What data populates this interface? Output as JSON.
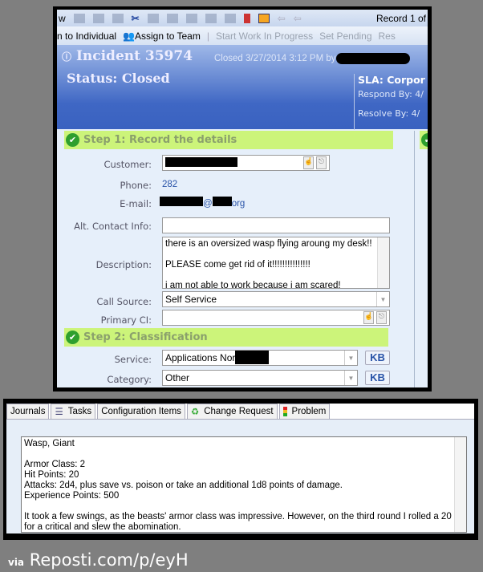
{
  "toolbar": {
    "view_fragment": "w",
    "record": "Record 1 of"
  },
  "actions": {
    "assign_individual": "n to Individual",
    "assign_team": "Assign to Team",
    "start_wip": "Start Work In Progress",
    "set_pending": "Set Pending",
    "resolve": "Res"
  },
  "header": {
    "incident": "Incident 35974",
    "closed": "Closed  3/27/2014 3:12 PM by",
    "status": "Status: Closed",
    "sla": "SLA: Corpor",
    "respond": "Respond By: 4/",
    "resolve": "Resolve By: 4/"
  },
  "step1": {
    "title": "Step 1:  Record the details",
    "customer_label": "Customer:",
    "phone_label": "Phone:",
    "phone": "282",
    "email_label": "E-mail:",
    "email_at": "@",
    "email_tld": "org",
    "alt_label": "Alt. Contact Info:",
    "alt_value": "",
    "desc_label": "Description:",
    "description": "there is an oversized wasp flying aroung my desk!!\n\nPLEASE come get rid of it!!!!!!!!!!!!!!!\n\ni am not able to work because i am scared!",
    "call_source_label": "Call Source:",
    "call_source": "Self Service",
    "primary_ci_label": "Primary CI:",
    "primary_ci": ""
  },
  "step2": {
    "title": "Step 2:  Classification",
    "service_label": "Service:",
    "service": "Applications Nor",
    "category_label": "Category:",
    "category": "Other",
    "kb": "KB"
  },
  "tabs": [
    "Journals",
    "Tasks",
    "Configuration Items",
    "Change Request",
    "Problem"
  ],
  "journal": "Wasp, Giant\n\nArmor Class: 2\nHit Points: 20\nAttacks: 2d4, plus save vs. poison or take an additional 1d8 points of damage.\nExperience Points: 500\n\nIt took a few swings, as the beasts' armor class was impressive. However, on the third round I rolled a 20 for a critical and slew the abomination.",
  "watermark": {
    "via": "via",
    "site": "Reposti.com/p/eyH"
  }
}
